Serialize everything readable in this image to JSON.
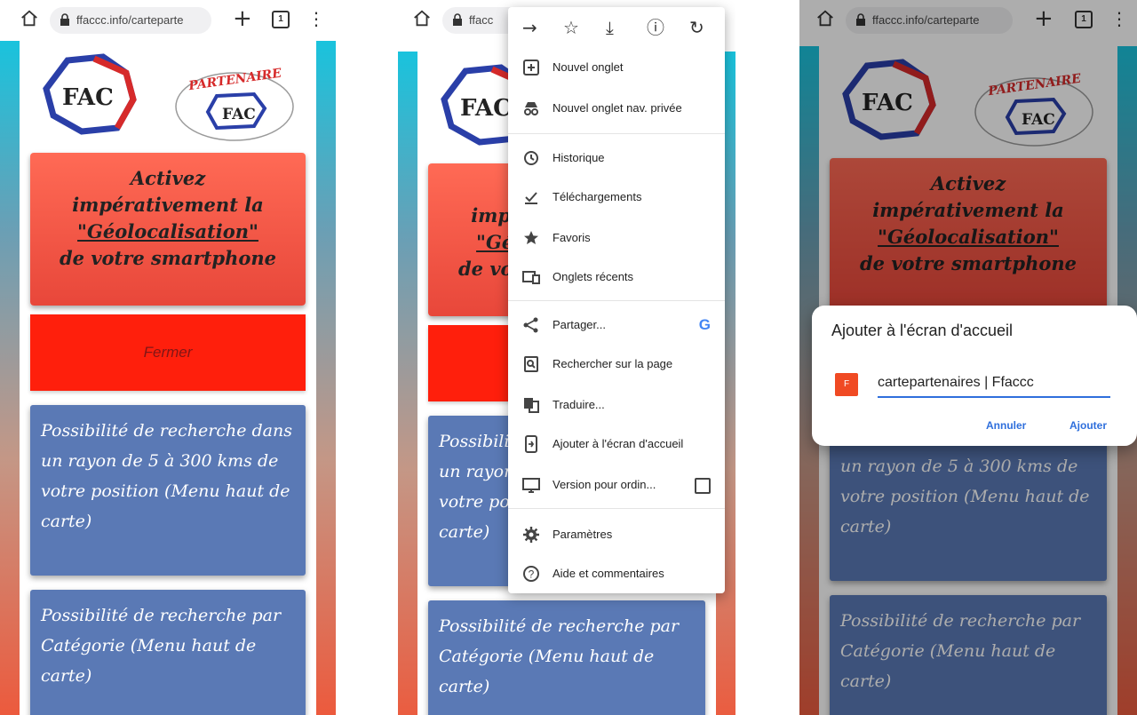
{
  "browser": {
    "url_short": "ffaccc.info/carteparte",
    "url_truncated": "ffacc",
    "tab_count": "1"
  },
  "page": {
    "logo_text": "PARTENAIRE",
    "alert_lines": [
      "Activez",
      "impérativement la",
      "\"Géolocalisation\"",
      "de votre smartphone"
    ],
    "close_label": "Fermer",
    "radius_text": "Possibilité de recherche dans un rayon de 5 à 300 kms de votre position (Menu haut de carte)",
    "category_text": "Possibilité de recherche par Catégorie (Menu haut de carte)"
  },
  "menu": {
    "items": [
      {
        "label": "Nouvel onglet",
        "icon": "new-tab-icon"
      },
      {
        "label": "Nouvel onglet nav. privée",
        "icon": "incognito-icon"
      },
      {
        "label": "Historique",
        "icon": "history-icon"
      },
      {
        "label": "Téléchargements",
        "icon": "downloads-icon"
      },
      {
        "label": "Favoris",
        "icon": "star-icon"
      },
      {
        "label": "Onglets récents",
        "icon": "recent-tabs-icon"
      },
      {
        "label": "Partager...",
        "icon": "share-icon"
      },
      {
        "label": "Rechercher sur la page",
        "icon": "find-in-page-icon"
      },
      {
        "label": "Traduire...",
        "icon": "translate-icon"
      },
      {
        "label": "Ajouter à l'écran d'accueil",
        "icon": "add-home-icon"
      },
      {
        "label": "Version pour ordin...",
        "icon": "desktop-icon"
      },
      {
        "label": "Paramètres",
        "icon": "settings-icon"
      },
      {
        "label": "Aide et commentaires",
        "icon": "help-icon"
      }
    ]
  },
  "dialog": {
    "title": "Ajouter à l'écran d'accueil",
    "favicon_letter": "F",
    "input_value": "cartepartenaires | Ffaccc",
    "cancel_label": "Annuler",
    "add_label": "Ajouter"
  },
  "colors": {
    "alert_red": "#ff5a45",
    "close_red": "#ff1f0c",
    "card_blue": "#5a79b5",
    "accent_blue": "#2f6fdc"
  }
}
